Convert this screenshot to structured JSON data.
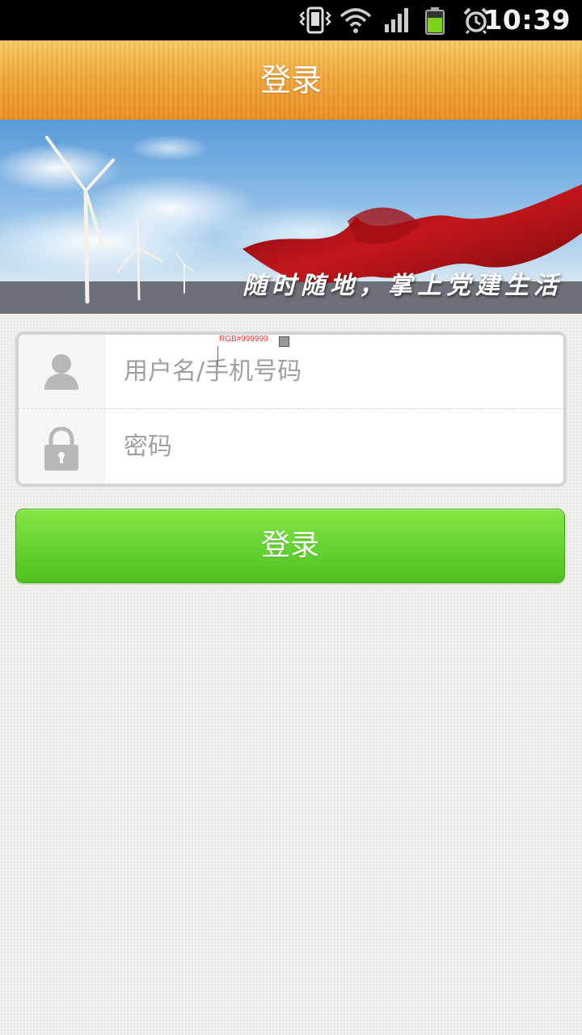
{
  "status_bar": {
    "time": "10:39",
    "icons": [
      "vibrate-icon",
      "wifi-icon",
      "signal-icon",
      "battery-icon",
      "alarm-icon"
    ]
  },
  "header": {
    "title": "登录"
  },
  "banner": {
    "slogan": "随时随地，掌上党建生活"
  },
  "form": {
    "username_placeholder": "用户名/手机号码",
    "username_value": "",
    "password_placeholder": "密码",
    "password_value": "",
    "annotation": "RGB#999999"
  },
  "login_button": {
    "label": "登录"
  },
  "colors": {
    "header": "#f2a63a",
    "button": "#6ad636",
    "placeholder": "#999999",
    "background": "#f1efea"
  }
}
